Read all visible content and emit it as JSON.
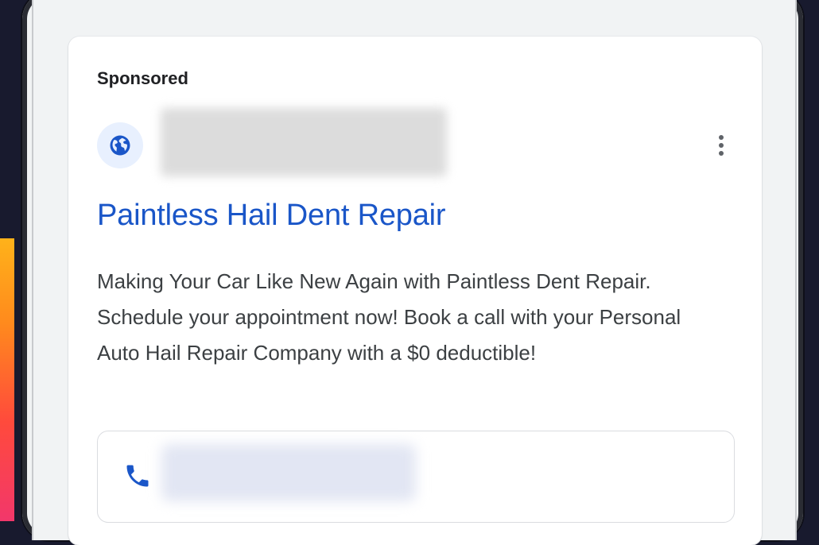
{
  "ad": {
    "label": "Sponsored",
    "headline": "Paintless Hail Dent Repair",
    "description": "Making Your Car Like New Again with Paintless Dent Repair. Schedule your appointment now! Book a call with your Personal Auto Hail Repair Company with a $0 deductible!"
  },
  "colors": {
    "headline": "#1a56c8",
    "icon_blue": "#1a56c8",
    "icon_bg": "#e8f0fe"
  },
  "icons": {
    "site": "globe-icon",
    "menu": "more-vert-icon",
    "call": "phone-icon"
  }
}
